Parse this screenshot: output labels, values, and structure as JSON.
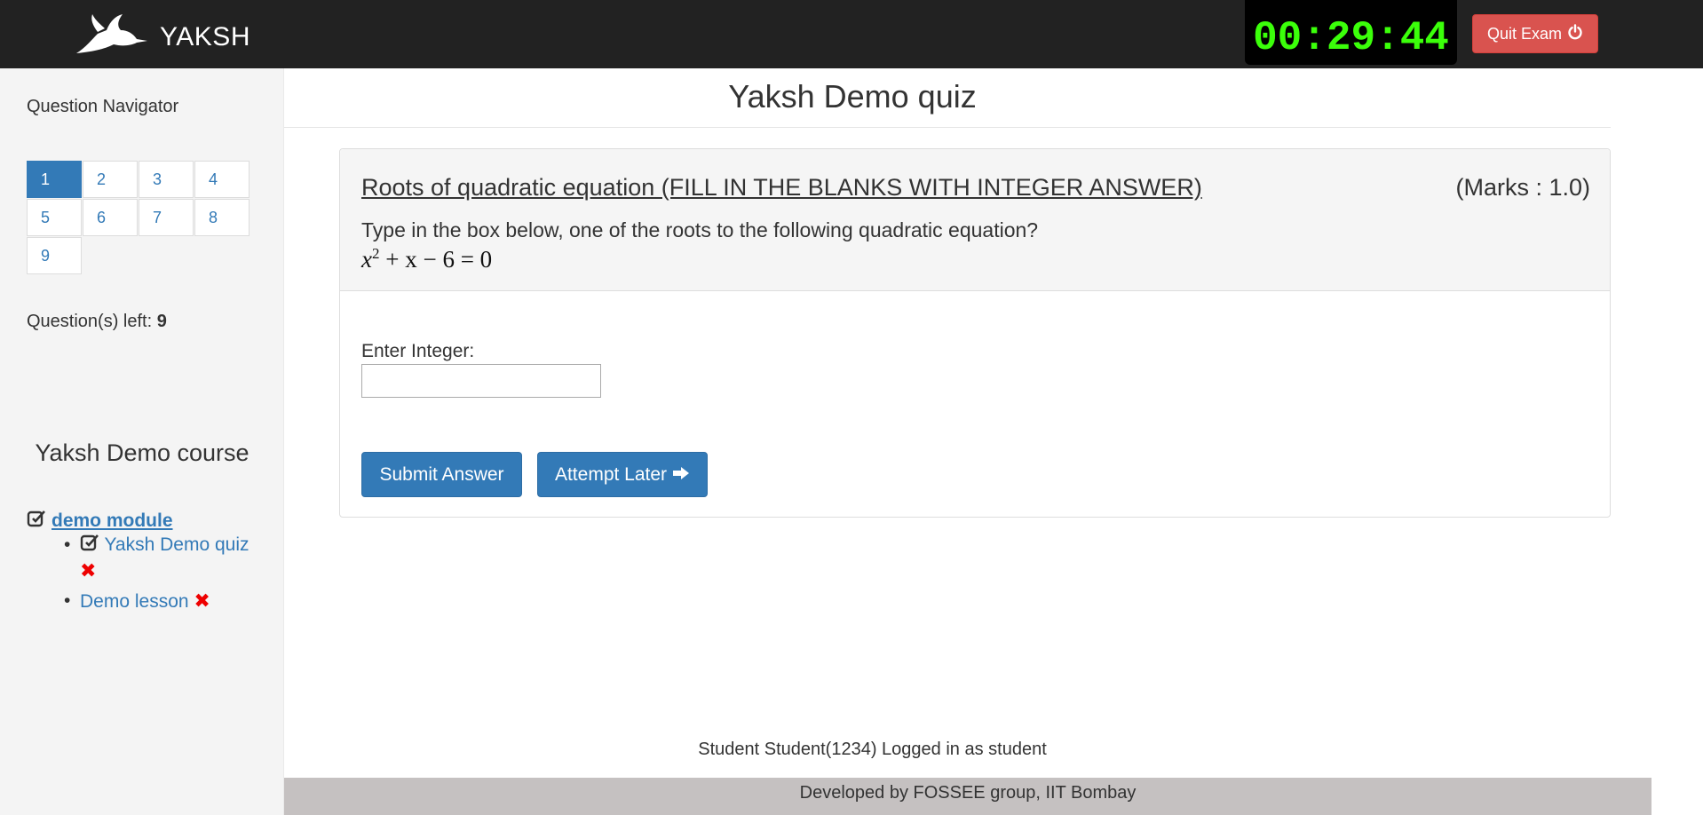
{
  "navbar": {
    "brand": "YAKSH",
    "timer": "00:29:44",
    "quit_label": "Quit Exam"
  },
  "sidebar": {
    "navigator_title": "Question Navigator",
    "questions": [
      "1",
      "2",
      "3",
      "4",
      "5",
      "6",
      "7",
      "8",
      "9"
    ],
    "active_question": "1",
    "questions_left_label": "Question(s) left:",
    "questions_left_count": "9",
    "course_title": "Yaksh Demo course",
    "module_name": "demo module",
    "items": [
      {
        "label": "Yaksh Demo quiz",
        "status": "✖"
      },
      {
        "label": "Demo lesson",
        "status": "✖"
      }
    ]
  },
  "main": {
    "quiz_title": "Yaksh Demo quiz",
    "question_title": "Roots of quadratic equation (FILL IN THE BLANKS WITH INTEGER ANSWER)",
    "marks": "(Marks : 1.0)",
    "question_text": "Type in the box below, one of the roots to the following quadratic equation?",
    "equation": {
      "base": "x",
      "exp": "2",
      "rest": "+ x − 6 = 0"
    },
    "answer_label": "Enter Integer:",
    "answer_value": "",
    "submit_label": "Submit Answer",
    "later_label": "Attempt Later"
  },
  "footer": {
    "logged_in": "Student Student(1234) Logged in as student",
    "developed_by": "Developed by FOSSEE group, IIT Bombay"
  },
  "colors": {
    "navbar_bg": "#222222",
    "timer_fg": "#3bff0a",
    "quit_bg": "#d9534f",
    "primary": "#337ab7",
    "fail_mark": "#ee0000"
  }
}
